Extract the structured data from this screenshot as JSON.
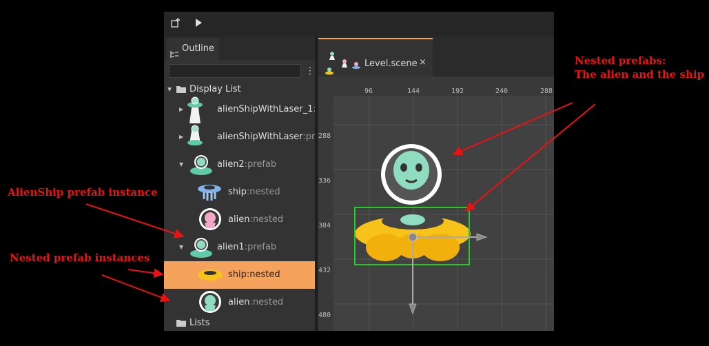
{
  "toolbar": {
    "add_icon": "add-object-icon",
    "play_icon": "play-icon"
  },
  "outline": {
    "tab_label": "Outline",
    "search": {
      "value": "",
      "placeholder": ""
    },
    "display_list_label": "Display List",
    "lists_label": "Lists",
    "items": [
      {
        "name": "alienShipWithLaser_1",
        "suffix": ":",
        "icon": "alien-ship-laser-icon"
      },
      {
        "name": "alienShipWithLaser",
        "suffix": ":pre",
        "icon": "alien-ship-laser-icon"
      },
      {
        "name": "alien2",
        "suffix": ":prefab",
        "icon": "alien-ship-icon"
      },
      {
        "name": "ship",
        "suffix": ":nested",
        "icon": "blue-ship-icon"
      },
      {
        "name": "alien",
        "suffix": ":nested",
        "icon": "pink-alien-icon"
      },
      {
        "name": "alien1",
        "suffix": ":prefab",
        "icon": "alien-ship-icon"
      },
      {
        "name": "ship",
        "suffix": ":nested",
        "icon": "yellow-ship-icon"
      },
      {
        "name": "alien",
        "suffix": ":nested",
        "icon": "green-alien-icon"
      }
    ]
  },
  "editor": {
    "tab_label": "Level.scene",
    "close_symbol": "×",
    "ruler_x": [
      "96",
      "144",
      "192",
      "240",
      "288"
    ],
    "ruler_y": [
      "288",
      "336",
      "384",
      "432",
      "480"
    ]
  },
  "annotations": {
    "nested_prefabs": [
      "Nested prefabs:",
      "The alien and the ship"
    ],
    "alienship_instance": "AlienShip prefab instance",
    "nested_instances": "Nested prefab instances"
  },
  "colors": {
    "accent": "#f5a25d",
    "annotation": "#ee1111",
    "selection": "#22cc22"
  }
}
